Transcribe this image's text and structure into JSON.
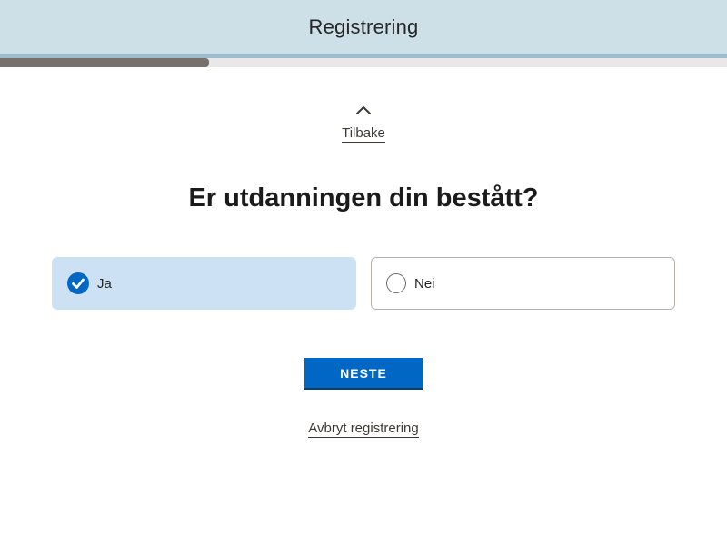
{
  "header": {
    "title": "Registrering",
    "background_color": "#cde0e8"
  },
  "progress": {
    "fraction": 0.2875,
    "fill_color": "#78706a"
  },
  "back": {
    "label": "Tilbake",
    "icon": "chevron-up-icon"
  },
  "question": {
    "text": "Er utdanningen din bestått?"
  },
  "options": [
    {
      "label": "Ja",
      "selected": true
    },
    {
      "label": "Nei",
      "selected": false
    }
  ],
  "next_button": {
    "label": "NESTE",
    "color": "#0067c5"
  },
  "cancel": {
    "label": "Avbryt registrering"
  }
}
